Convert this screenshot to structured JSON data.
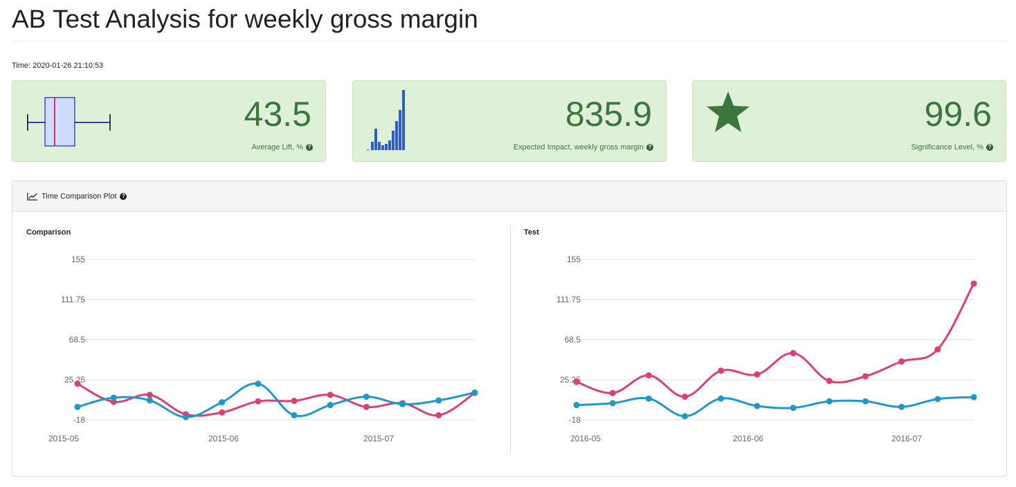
{
  "header": {
    "title": "AB Test Analysis for weekly gross margin",
    "time": "Time: 2020-01-26 21:10:53"
  },
  "cards": [
    {
      "value": "43.5",
      "label": "Average Lift, %",
      "icon": "boxplot-icon"
    },
    {
      "value": "835.9",
      "label": "Expected Impact, weekly gross margin",
      "icon": "histogram-icon"
    },
    {
      "value": "99.6",
      "label": "Significance Level, %",
      "icon": "star-icon"
    }
  ],
  "panel": {
    "title": "Time Comparison Plot",
    "icon": "line-chart-icon"
  },
  "colors": {
    "pink": "#dc3f76",
    "blue": "#1f98c9",
    "card_bg": "#dff0d8",
    "card_text": "#3c763d"
  },
  "chart_data": [
    {
      "type": "line",
      "title": "Comparison",
      "ylim": [
        -18,
        155
      ],
      "yticks": [
        "155",
        "111.75",
        "68.5",
        "25.25",
        "-18"
      ],
      "xticks": [
        "2015-05",
        "2015-06",
        "2015-07"
      ],
      "grid": true,
      "series": [
        {
          "color": "#dc3f76",
          "values": [
            21,
            1.5,
            9,
            -12,
            -10,
            2,
            2.5,
            9,
            -4,
            0,
            -13,
            11
          ]
        },
        {
          "color": "#1f98c9",
          "values": [
            -4,
            6,
            3,
            -15,
            1,
            21,
            -13,
            -2,
            7,
            -1,
            3,
            11.5
          ]
        }
      ]
    },
    {
      "type": "line",
      "title": "Test",
      "ylim": [
        -18,
        155
      ],
      "yticks": [
        "155",
        "111.75",
        "68.5",
        "25.25",
        "-18"
      ],
      "xticks": [
        "2016-05",
        "2016-06",
        "2016-07"
      ],
      "grid": true,
      "series": [
        {
          "color": "#dc3f76",
          "values": [
            23,
            11,
            30,
            7,
            35,
            31,
            54,
            24,
            29,
            45,
            58,
            129
          ]
        },
        {
          "color": "#1f98c9",
          "values": [
            -2,
            0,
            5,
            -14,
            5,
            -3,
            -5,
            2,
            2,
            -4,
            4.5,
            6.5
          ]
        }
      ]
    }
  ]
}
